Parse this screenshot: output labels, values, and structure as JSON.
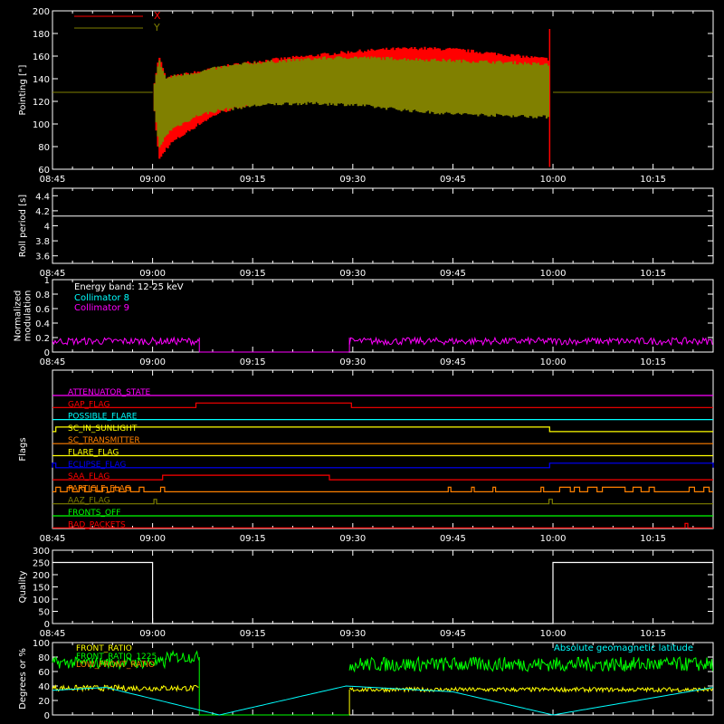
{
  "time_axis": {
    "ticks": [
      "08:45",
      "09:00",
      "09:15",
      "09:30",
      "09:45",
      "10:00",
      "10:15"
    ],
    "range_minutes": [
      0,
      99
    ]
  },
  "colors": {
    "frame": "#ffffff",
    "red": "#ff0000",
    "olive": "#808000",
    "cyan": "#00ffff",
    "magenta": "#ff00ff",
    "yellow": "#ffff00",
    "green": "#00ff00",
    "blue": "#0000ff",
    "orange": "#ff8000",
    "white": "#ffffff"
  },
  "chart_data": [
    {
      "id": "pointing",
      "type": "line",
      "ylabel": "Pointing [\"]",
      "ylim": [
        60,
        200
      ],
      "yticks": [
        60,
        80,
        100,
        120,
        140,
        160,
        180,
        200
      ],
      "legend": {
        "placement": "top-left"
      },
      "series": [
        {
          "name": "X",
          "color": "#ff0000",
          "x_minutes": [
            0,
            15,
            16,
            17,
            18,
            20,
            22,
            25,
            30,
            35,
            40,
            45,
            50,
            55,
            60,
            65,
            70,
            75,
            74,
            75,
            99
          ],
          "upper": [
            128,
            128,
            160,
            140,
            142,
            144,
            146,
            150,
            155,
            158,
            161,
            164,
            166,
            167,
            166,
            163,
            160,
            157,
            157,
            157,
            128
          ],
          "lower": [
            128,
            128,
            68,
            78,
            84,
            92,
            100,
            110,
            118,
            122,
            124,
            125,
            123,
            120,
            117,
            114,
            112,
            110,
            110,
            110,
            128
          ],
          "spike": {
            "x": 74.5,
            "range": [
              62,
              184
            ]
          },
          "baseline": 128
        },
        {
          "name": "Y",
          "color": "#808000",
          "x_minutes": [
            0,
            15,
            16,
            17,
            18,
            20,
            22,
            25,
            30,
            35,
            40,
            45,
            50,
            55,
            60,
            65,
            70,
            75,
            74,
            75,
            99
          ],
          "upper": [
            128,
            128,
            156,
            140,
            142,
            144,
            146,
            150,
            154,
            156,
            158,
            159,
            158,
            157,
            156,
            155,
            154,
            152,
            152,
            152,
            128
          ],
          "lower": [
            128,
            128,
            78,
            90,
            96,
            102,
            108,
            112,
            116,
            118,
            118,
            117,
            114,
            111,
            109,
            108,
            107,
            106,
            106,
            106,
            128
          ],
          "baseline": 128
        }
      ]
    },
    {
      "id": "roll",
      "type": "line",
      "ylabel": "Roll period [s]",
      "ylim": [
        3.5,
        4.5
      ],
      "yticks": [
        3.6,
        3.8,
        4.0,
        4.2,
        4.4
      ],
      "series": [
        {
          "color": "#ffffff",
          "x_minutes": [
            0,
            99
          ],
          "values": [
            4.13,
            4.13
          ]
        }
      ]
    },
    {
      "id": "modulation",
      "type": "line",
      "ylabel_lines": [
        "Normalized",
        "modulation"
      ],
      "ylim": [
        0,
        1.0
      ],
      "yticks": [
        0.0,
        0.2,
        0.4,
        0.6,
        0.8,
        1.0
      ],
      "annotations": [
        "Energy band: 12-25 keV"
      ],
      "legend": {
        "placement": "top-left"
      },
      "series": [
        {
          "name": "Collimator 8",
          "color": "#00ffff",
          "segments": []
        },
        {
          "name": "Collimator 9",
          "color": "#ff00ff",
          "segments": [
            {
              "x": [
                0,
                22
              ],
              "level": 0.15,
              "noise": 0.05
            },
            {
              "x": [
                22,
                44.5
              ],
              "level": 0.0,
              "noise": 0
            },
            {
              "x": [
                44.5,
                99
              ],
              "level": 0.15,
              "noise": 0.05
            }
          ]
        }
      ]
    },
    {
      "id": "flags",
      "type": "line",
      "ylabel": "Flags",
      "rows": [
        {
          "name": "ATTENUATOR_STATE",
          "color": "#ff00ff",
          "on": []
        },
        {
          "name": "GAP_FLAG",
          "color": "#ff0000",
          "on": [
            [
              21.5,
              44.8
            ]
          ]
        },
        {
          "name": "POSSIBLE_FLARE",
          "color": "#00ffff",
          "on": []
        },
        {
          "name": "SC_IN_SUNLIGHT",
          "color": "#ffff00",
          "on": [
            [
              0.5,
              74.5
            ]
          ]
        },
        {
          "name": "SC_TRANSMITTER",
          "color": "#ff8000",
          "on": []
        },
        {
          "name": "FLARE_FLAG",
          "color": "#ffff00",
          "on": []
        },
        {
          "name": "ECLIPSE_FLAG",
          "color": "#0000ff",
          "on": [
            [
              0,
              0.5
            ],
            [
              74.5,
              99
            ]
          ]
        },
        {
          "name": "SAA_FLAG",
          "color": "#ff0000",
          "on": [
            [
              16.5,
              41.5
            ]
          ]
        },
        {
          "name": "PARTICLE_FLAG",
          "color": "#ff8000",
          "on": [
            [
              0.5,
              1.2
            ],
            [
              2.2,
              3.0
            ],
            [
              4.0,
              4.8
            ],
            [
              5.8,
              6.5
            ],
            [
              7.5,
              8.2
            ],
            [
              9.2,
              10.0
            ],
            [
              11.0,
              11.7
            ],
            [
              13.0,
              13.7
            ],
            [
              16.2,
              16.8
            ],
            [
              59.3,
              59.7
            ],
            [
              62.8,
              63.2
            ],
            [
              66.0,
              66.4
            ],
            [
              73.2,
              73.6
            ],
            [
              76.0,
              77.6
            ],
            [
              78.2,
              79.0
            ],
            [
              80.2,
              81.6
            ],
            [
              82.4,
              85.8
            ],
            [
              87.0,
              88.2
            ],
            [
              89.4,
              90.2
            ],
            [
              95.4,
              96.2
            ],
            [
              97.6,
              98.4
            ]
          ]
        },
        {
          "name": "AAZ_FLAG",
          "color": "#808000",
          "on": [
            [
              15.2,
              15.6
            ],
            [
              74.4,
              74.9
            ]
          ]
        },
        {
          "name": "FRONTS_OFF",
          "color": "#00ff00",
          "on": []
        },
        {
          "name": "BAD_PACKETS",
          "color": "#ff0000",
          "on": [
            [
              94.8,
              95.2
            ]
          ]
        }
      ]
    },
    {
      "id": "quality",
      "type": "line",
      "ylabel": "Quality",
      "ylim": [
        0,
        300
      ],
      "yticks": [
        0,
        50,
        100,
        150,
        200,
        250,
        300
      ],
      "series": [
        {
          "color": "#ffffff",
          "x_minutes": [
            0,
            15,
            15,
            75,
            75,
            99
          ],
          "values": [
            250,
            250,
            0,
            0,
            250,
            250
          ]
        }
      ]
    },
    {
      "id": "front",
      "type": "line",
      "ylabel": "Degrees or %",
      "ylim": [
        0,
        100
      ],
      "yticks": [
        0,
        20,
        40,
        60,
        80,
        100
      ],
      "legend": {
        "placement": "top-left"
      },
      "annotations": [
        "Absolute geomagnetic latitude"
      ],
      "series": [
        {
          "name": "FRONT_RATIO",
          "color": "#ffff00",
          "segments": [
            {
              "x": [
                0,
                22
              ],
              "level": 37,
              "noise": 4
            },
            {
              "x": [
                22,
                44.5
              ],
              "level": 0,
              "noise": 0
            },
            {
              "x": [
                44.5,
                99
              ],
              "level": 35,
              "noise": 3
            }
          ]
        },
        {
          "name": "FRONT_RATIO_1225",
          "color": "#00ff00",
          "segments": [
            {
              "x": [
                0,
                17
              ],
              "level": 72,
              "noise": 8
            },
            {
              "x": [
                17,
                22
              ],
              "level": 80,
              "noise": 8
            },
            {
              "x": [
                22,
                44.5
              ],
              "level": 0,
              "noise": 0
            },
            {
              "x": [
                44.5,
                99
              ],
              "level": 70,
              "noise": 10
            }
          ]
        },
        {
          "name": "LOW_FRONT_RATIO",
          "color": "#ff8000",
          "segments": []
        },
        {
          "name": "Absolute geomagnetic latitude",
          "color": "#00ffff",
          "x_minutes": [
            0,
            8,
            25,
            44,
            60,
            75,
            99
          ],
          "values": [
            34,
            38,
            0,
            40,
            32,
            0,
            38
          ]
        }
      ]
    }
  ]
}
